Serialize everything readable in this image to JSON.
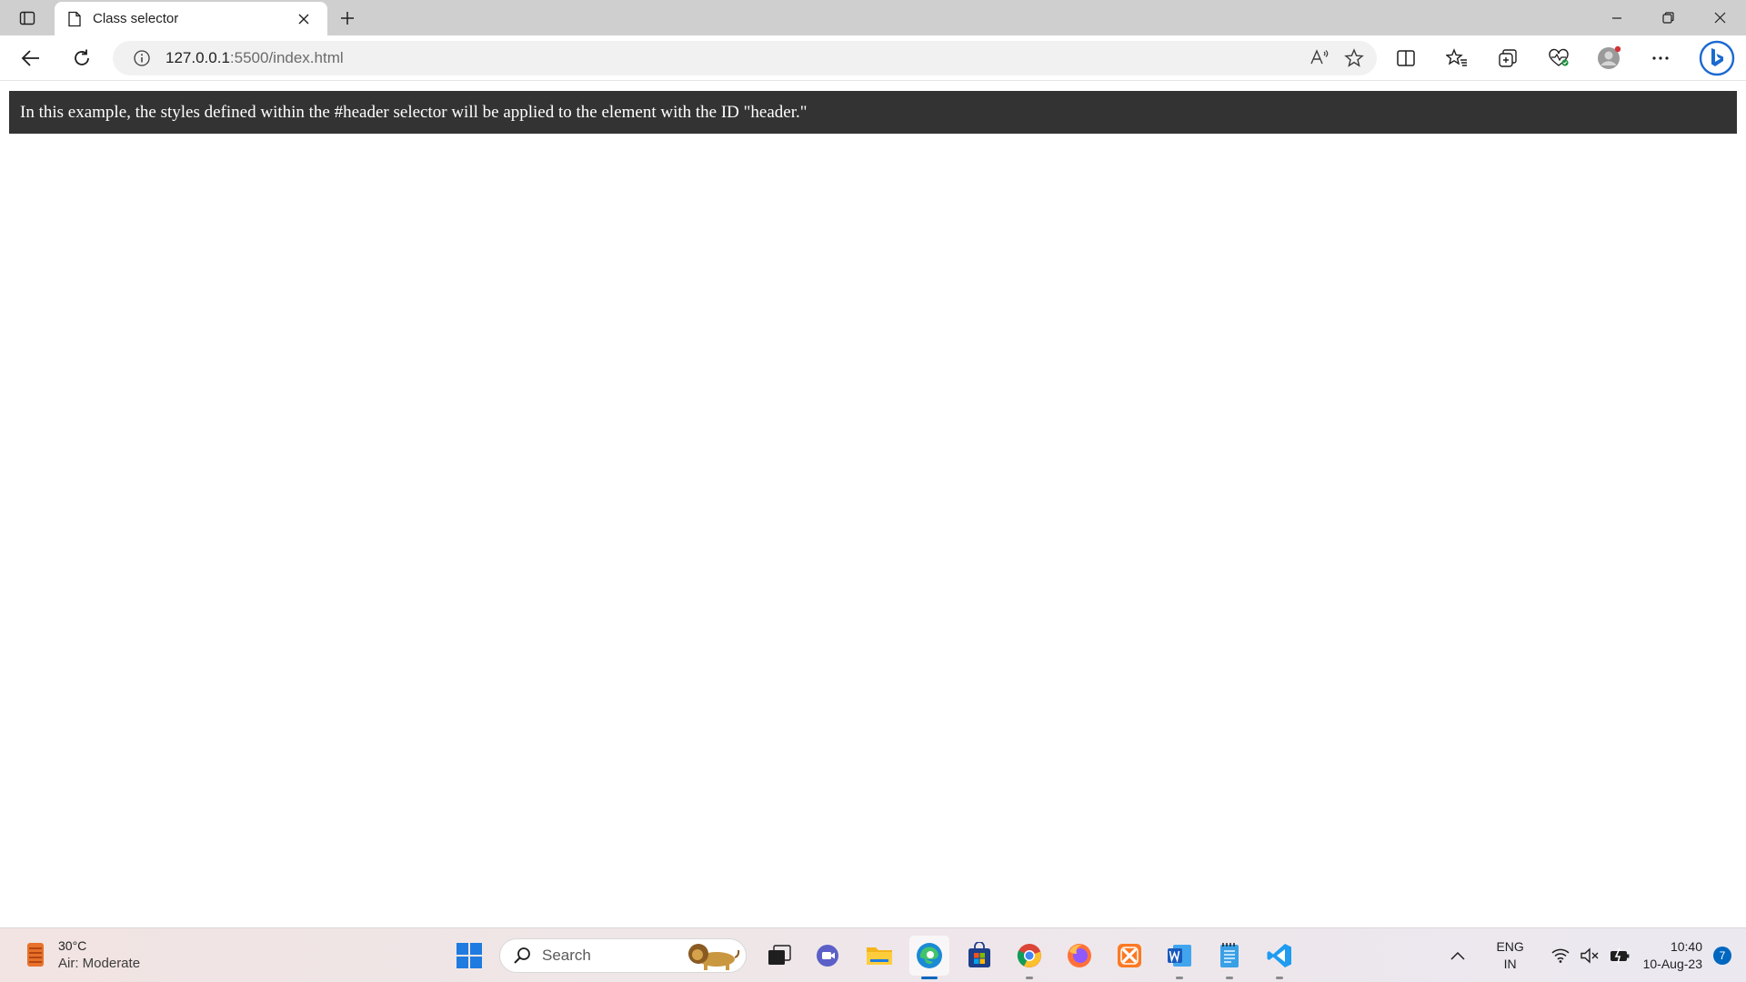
{
  "browser": {
    "tab_title": "Class selector",
    "url_host": "127.0.0.1",
    "url_path": ":5500/index.html"
  },
  "page": {
    "header_text": "In this example, the styles defined within the #header selector will be applied to the element with the ID \"header.\""
  },
  "taskbar": {
    "weather_temp": "30°C",
    "weather_desc": "Air: Moderate",
    "search_placeholder": "Search",
    "lang_top": "ENG",
    "lang_bottom": "IN",
    "time": "10:40",
    "date": "10-Aug-23",
    "notification_count": "7"
  },
  "colors": {
    "header_bg": "#333333",
    "header_text": "#ffffff",
    "accent": "#0067c0"
  }
}
